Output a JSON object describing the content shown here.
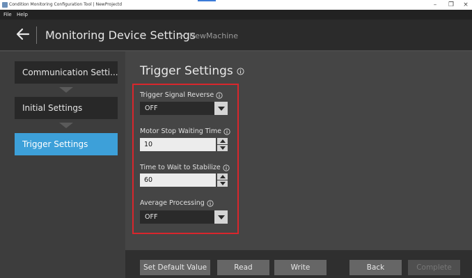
{
  "window": {
    "title": "Condition Monitoring Configuration Tool | NewProjectd",
    "controls": {
      "minimize": "–",
      "maximize": "❐",
      "close": "×"
    }
  },
  "menu": {
    "items": [
      {
        "label": "File"
      },
      {
        "label": "Help"
      }
    ]
  },
  "header": {
    "back_icon": "arrow-left-icon",
    "title": "Monitoring Device Settings",
    "breadcrumb_separator": ">",
    "breadcrumb": "NewMachine"
  },
  "sidebar": {
    "steps": [
      {
        "label": "Communication Setti...",
        "state": "default"
      },
      {
        "label": "Initial Settings",
        "state": "default"
      },
      {
        "label": "Trigger Settings",
        "state": "active"
      }
    ]
  },
  "main": {
    "section_title": "Trigger Settings",
    "fields": [
      {
        "label": "Trigger Signal Reverse",
        "type": "dropdown",
        "value": "OFF"
      },
      {
        "label": "Motor Stop Waiting Time",
        "type": "spinner",
        "value": "10"
      },
      {
        "label": "Time to Wait to Stabilize",
        "type": "spinner",
        "value": "60"
      },
      {
        "label": "Average Processing",
        "type": "dropdown",
        "value": "OFF"
      }
    ]
  },
  "footer": {
    "buttons": [
      {
        "label": "Set Default Value",
        "enabled": true
      },
      {
        "label": "Read",
        "enabled": true
      },
      {
        "label": "Write",
        "enabled": true
      },
      {
        "label": "Back",
        "enabled": true
      },
      {
        "label": "Complete",
        "enabled": false
      }
    ]
  },
  "colors": {
    "accent": "#3da0d9",
    "highlight": "#d9262c",
    "background": "#3f3f3f"
  }
}
